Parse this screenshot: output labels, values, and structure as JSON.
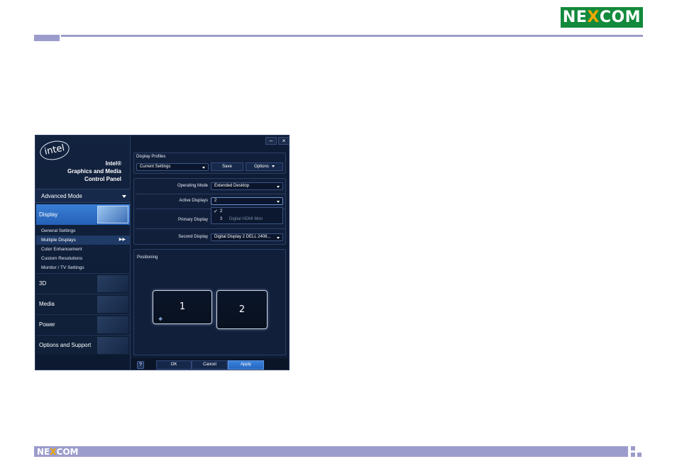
{
  "header": {
    "logo_main": "NE",
    "logo_x": "X",
    "logo_tail": "COM"
  },
  "footer": {
    "logo_main": "NE",
    "logo_x": "X",
    "logo_tail": "COM"
  },
  "window": {
    "brand_line1": "Intel®",
    "brand_line2": "Graphics and Media",
    "brand_line3": "Control Panel",
    "intel_logo": "intel",
    "min_label": "–",
    "close_label": "×",
    "mode_label": "Advanced Mode",
    "sidebar": {
      "active_category": "Display",
      "subitems": [
        "General Settings",
        "Multiple Displays",
        "Color Enhancement",
        "Custom Resolutions",
        "Monitor / TV Settings"
      ],
      "categories": [
        "3D",
        "Media",
        "Power",
        "Options and Support"
      ]
    },
    "profiles": {
      "label": "Display Profiles",
      "current": "Current Settings",
      "save": "Save",
      "options": "Options"
    },
    "settings": {
      "operating_mode_label": "Operating Mode",
      "operating_mode_value": "Extended Desktop",
      "active_displays_label": "Active Displays",
      "active_displays_value": "2",
      "primary_display_label": "Primary Display",
      "second_display_label": "Second Display",
      "second_display_value": "Digital Display 2 DELL 2408...",
      "dropdown_options": [
        "2",
        "3"
      ],
      "dropdown_faded_text": "Digital HDMI Mon"
    },
    "positioning": {
      "label": "Positioning",
      "monitor1": "1",
      "monitor2": "2"
    },
    "buttons": {
      "help": "?",
      "ok": "OK",
      "cancel": "Cancel",
      "apply": "Apply"
    }
  },
  "colors": {
    "accent_bar": "#9c9ccc",
    "brand_green": "#118a3c",
    "selected_blue": "#2f72cc"
  }
}
